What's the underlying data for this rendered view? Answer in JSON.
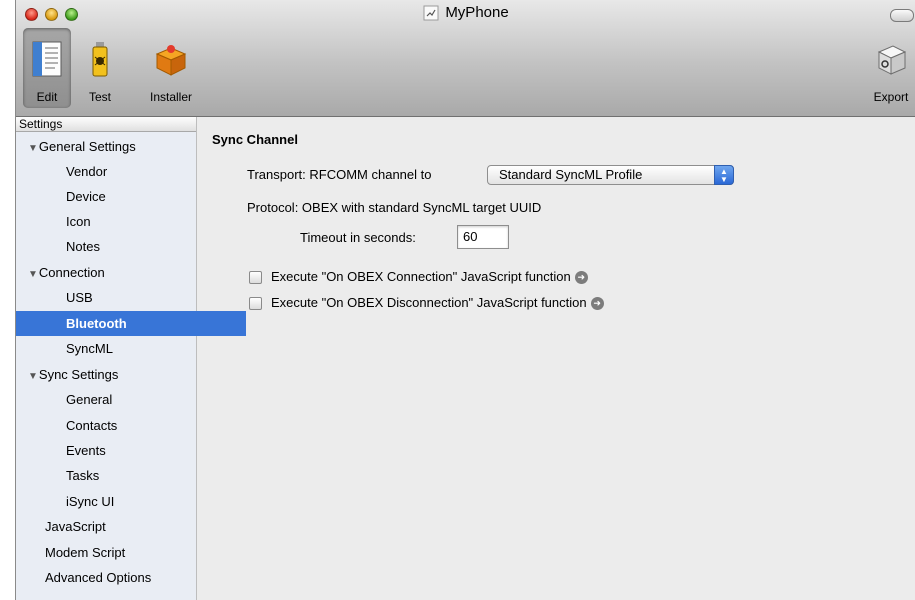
{
  "window": {
    "title": "MyPhone"
  },
  "toolbar": {
    "items": [
      {
        "label": "Edit",
        "icon": "edit-document-icon",
        "selected": true
      },
      {
        "label": "Test",
        "icon": "bug-spray-icon"
      },
      {
        "label": "Installer",
        "icon": "package-icon"
      },
      {
        "label": "Export",
        "icon": "export-lego-icon"
      }
    ]
  },
  "sidebar": {
    "header": "Settings",
    "items": [
      {
        "label": "General Settings",
        "group": true
      },
      {
        "label": "Vendor"
      },
      {
        "label": "Device"
      },
      {
        "label": "Icon"
      },
      {
        "label": "Notes"
      },
      {
        "label": "Connection",
        "group": true
      },
      {
        "label": "USB"
      },
      {
        "label": "Bluetooth",
        "selected": true
      },
      {
        "label": "SyncML"
      },
      {
        "label": "Sync Settings",
        "group": true
      },
      {
        "label": "General"
      },
      {
        "label": "Contacts"
      },
      {
        "label": "Events"
      },
      {
        "label": "Tasks"
      },
      {
        "label": "iSync UI"
      },
      {
        "label": "JavaScript"
      },
      {
        "label": "Modem Script"
      },
      {
        "label": "Advanced Options"
      }
    ]
  },
  "main": {
    "section_title": "Sync Channel",
    "transport_label": "Transport:",
    "transport_prefix": "RFCOMM channel to",
    "transport_value": "Standard SyncML Profile",
    "protocol_text": "Protocol: OBEX with standard SyncML target UUID",
    "timeout_label": "Timeout in seconds:",
    "timeout_value": "60",
    "checkbox_connect": "Execute \"On OBEX Connection\" JavaScript function",
    "checkbox_disconnect": "Execute \"On OBEX Disconnection\" JavaScript function"
  },
  "colors": {
    "selection": "#3875d7",
    "sidebar_bg": "#e9edf4",
    "window_bg": "#ececec"
  }
}
